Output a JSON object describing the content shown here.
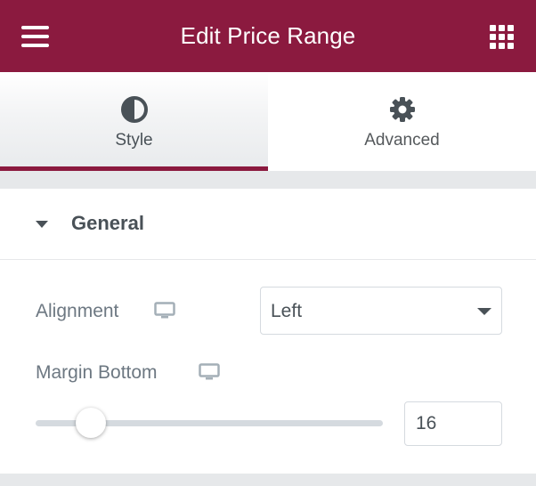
{
  "header": {
    "title": "Edit Price Range",
    "menu_icon": "hamburger-icon",
    "apps_icon": "grid-icon",
    "background": "#8b1a3f"
  },
  "tabs": [
    {
      "label": "Style",
      "icon": "contrast-half-circle-icon",
      "active": true
    },
    {
      "label": "Advanced",
      "icon": "gear-icon",
      "active": false
    }
  ],
  "section": {
    "title": "General",
    "expanded": true
  },
  "controls": {
    "alignment": {
      "label": "Alignment",
      "device_icon": "desktop-icon",
      "value": "Left"
    },
    "margin_bottom": {
      "label": "Margin Bottom",
      "device_icon": "desktop-icon",
      "value": "16"
    }
  },
  "colors": {
    "accent": "#8b1a3f",
    "text": "#495157",
    "muted": "#6d7882"
  }
}
